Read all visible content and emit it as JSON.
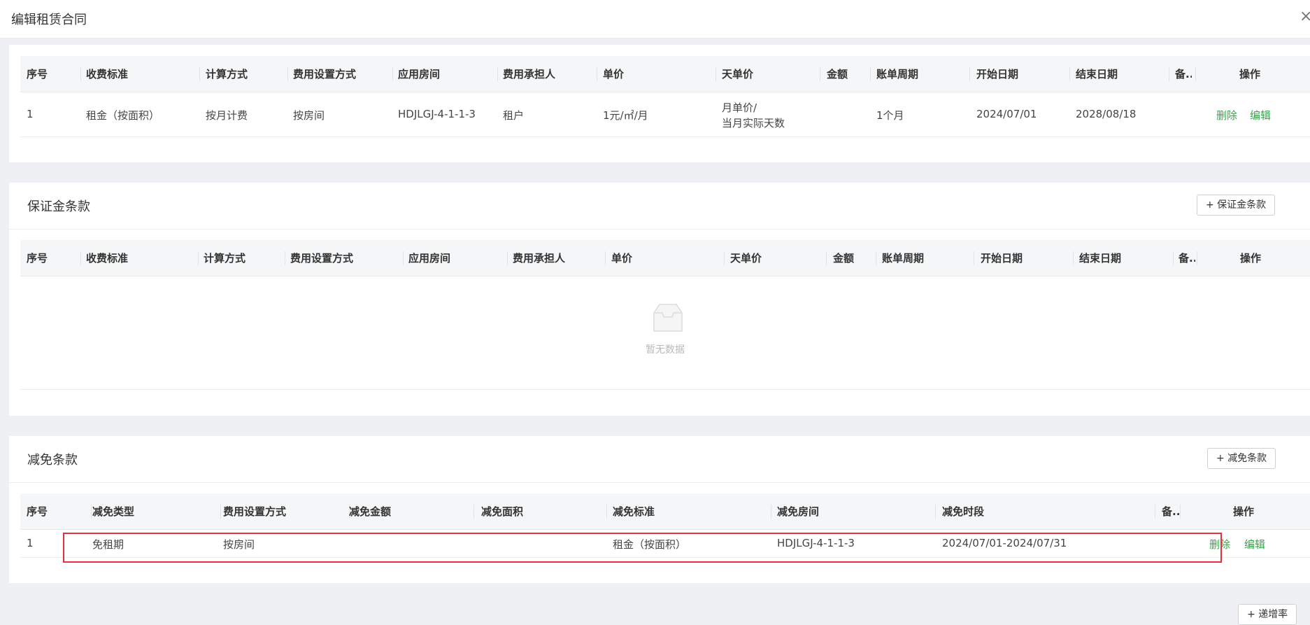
{
  "modal": {
    "title": "编辑租赁合同",
    "close": "×"
  },
  "fee_table": {
    "headers": [
      "序号",
      "收费标准",
      "计算方式",
      "费用设置方式",
      "应用房间",
      "费用承担人",
      "单价",
      "天单价",
      "金额",
      "账单周期",
      "开始日期",
      "结束日期",
      "备..",
      "操作"
    ],
    "rows": [
      {
        "no": "1",
        "standard": "租金（按面积）",
        "calc": "按月计费",
        "setting": "按房间",
        "room": "HDJLGJ-4-1-1-3",
        "payer": "租户",
        "unit_price": "1元/㎡/月",
        "day_price_line1": "月单价/",
        "day_price_line2": "当月实际天数",
        "amount": "",
        "cycle": "1个月",
        "start": "2024/07/01",
        "end": "2028/08/18",
        "remark": "",
        "delete": "删除",
        "edit": "编辑"
      }
    ]
  },
  "deposit": {
    "title": "保证金条款",
    "add_button": "+ 保证金条款",
    "headers": [
      "序号",
      "收费标准",
      "计算方式",
      "费用设置方式",
      "应用房间",
      "费用承担人",
      "单价",
      "天单价",
      "金额",
      "账单周期",
      "开始日期",
      "结束日期",
      "备..",
      "操作"
    ],
    "empty_text": "暂无数据"
  },
  "reduction": {
    "title": "减免条款",
    "add_button": "+ 减免条款",
    "headers": [
      "序号",
      "减免类型",
      "费用设置方式",
      "减免金额",
      "减免面积",
      "减免标准",
      "减免房间",
      "减免时段",
      "备..",
      "操作"
    ],
    "rows": [
      {
        "no": "1",
        "type": "免租期",
        "setting": "按房间",
        "amount": "",
        "area": "",
        "standard": "租金（按面积）",
        "room": "HDJLGJ-4-1-1-3",
        "period": "2024/07/01-2024/07/31",
        "remark": "",
        "delete": "删除",
        "edit": "编辑"
      }
    ]
  },
  "bottom": {
    "add_rate_button": "+ 递增率"
  },
  "colors": {
    "accent": "#3aa24f",
    "highlight": "#e0323a"
  }
}
